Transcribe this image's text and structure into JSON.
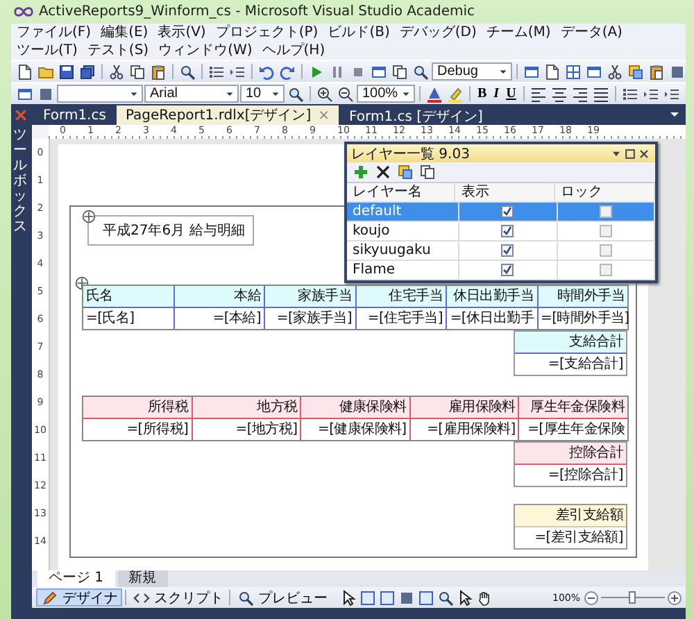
{
  "window": {
    "title": "ActiveReports9_Winform_cs - Microsoft Visual Studio Academic"
  },
  "menu": [
    "ファイル(F)",
    "編集(E)",
    "表示(V)",
    "プロジェクト(P)",
    "ビルド(B)",
    "デバッグ(D)",
    "チーム(M)",
    "データ(A)",
    "ツール(T)",
    "テスト(S)",
    "ウィンドウ(W)",
    "ヘルプ(H)"
  ],
  "toolbar": {
    "configuration": "Debug"
  },
  "format_toolbar": {
    "font": "Arial",
    "size": "10",
    "zoom": "100%",
    "styles": [
      "B",
      "I",
      "U"
    ]
  },
  "document_tabs": [
    {
      "label": "Form1.cs",
      "selected": false
    },
    {
      "label": "PageReport1.rdlx[デザイン]",
      "selected": true,
      "close": "×"
    },
    {
      "label": "Form1.cs [デザイン]",
      "selected": false
    }
  ],
  "toolbox": {
    "label": "ツールボックス"
  },
  "ruler": {
    "horizontal": [
      "0",
      "1",
      "2",
      "3",
      "4",
      "5",
      "6",
      "7",
      "8",
      "9",
      "10",
      "11",
      "12",
      "13",
      "14",
      "15",
      "16",
      "17",
      "18",
      "19"
    ],
    "vertical": [
      "0",
      "1",
      "2",
      "3",
      "4",
      "5",
      "6",
      "7",
      "8",
      "9",
      "10",
      "11",
      "12",
      "13",
      "14"
    ]
  },
  "report": {
    "title": "平成27年6月 給与明細",
    "payments": {
      "headers": [
        "氏名",
        "本給",
        "家族手当",
        "住宅手当",
        "休日出勤手当",
        "時間外手当"
      ],
      "fields": [
        "=[氏名]",
        "=[本給]",
        "=[家族手当]",
        "=[住宅手当]",
        "=[休日出勤手",
        "=[時間外手当]"
      ]
    },
    "payment_total": {
      "header": "支給合計",
      "field": "=[支給合計]"
    },
    "deductions": {
      "headers": [
        "所得税",
        "地方税",
        "健康保険料",
        "雇用保険料",
        "厚生年金保険料"
      ],
      "fields": [
        "=[所得税]",
        "=[地方税]",
        "=[健康保険料]",
        "=[雇用保険料]",
        "=[厚生年金保険"
      ]
    },
    "deduction_total": {
      "header": "控除合計",
      "field": "=[控除合計]"
    },
    "net_pay": {
      "header": "差引支給額",
      "field": "=[差引支給額]"
    }
  },
  "layer_panel": {
    "title": "レイヤー一覧 9.03",
    "columns": [
      "レイヤー名",
      "表示",
      "ロック"
    ],
    "layers": [
      {
        "name": "default",
        "selected": true,
        "visible": true,
        "locked": false
      },
      {
        "name": "koujo",
        "selected": false,
        "visible": true,
        "locked": false
      },
      {
        "name": "sikyuugaku",
        "selected": false,
        "visible": true,
        "locked": false
      },
      {
        "name": "Flame",
        "selected": false,
        "visible": true,
        "locked": false
      }
    ]
  },
  "page_tabs": [
    {
      "label": "ページ 1",
      "selected": true
    },
    {
      "label": "新規",
      "selected": false
    }
  ],
  "view_tabs": [
    {
      "label": "デザイナ",
      "selected": true
    },
    {
      "label": "スクリプト",
      "selected": false
    },
    {
      "label": "プレビュー",
      "selected": false
    }
  ],
  "zoom": {
    "reading": "100%",
    "level": 0.5
  }
}
